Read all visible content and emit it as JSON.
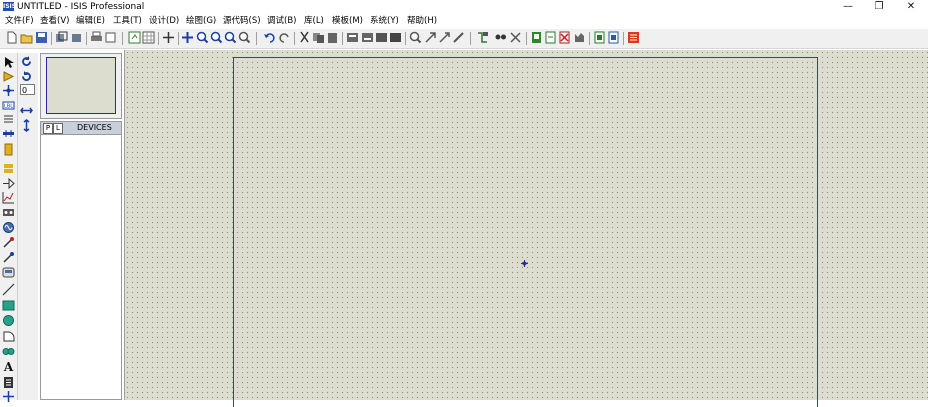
{
  "window": {
    "app_icon_text": "ISIS",
    "title": "UNTITLED - ISIS Professional",
    "controls": {
      "minimize": "—",
      "restore": "❐",
      "close": "✕"
    }
  },
  "menu": [
    {
      "label": "文件(F)"
    },
    {
      "label": "查看(V)"
    },
    {
      "label": "编辑(E)"
    },
    {
      "label": "工具(T)"
    },
    {
      "label": "设计(D)"
    },
    {
      "label": "绘图(G)"
    },
    {
      "label": "源代码(S)"
    },
    {
      "label": "调试(B)"
    },
    {
      "label": "库(L)"
    },
    {
      "label": "模板(M)"
    },
    {
      "label": "系统(Y)"
    },
    {
      "label": "帮助(H)"
    }
  ],
  "rotation": {
    "angle_value": "0"
  },
  "devices_panel": {
    "p_button": "P",
    "l_button": "L",
    "title": "DEVICES"
  },
  "colors": {
    "canvas": "#dcdccf",
    "sheet_border": "#3838b8",
    "app_icon": "#1d4fb5"
  }
}
